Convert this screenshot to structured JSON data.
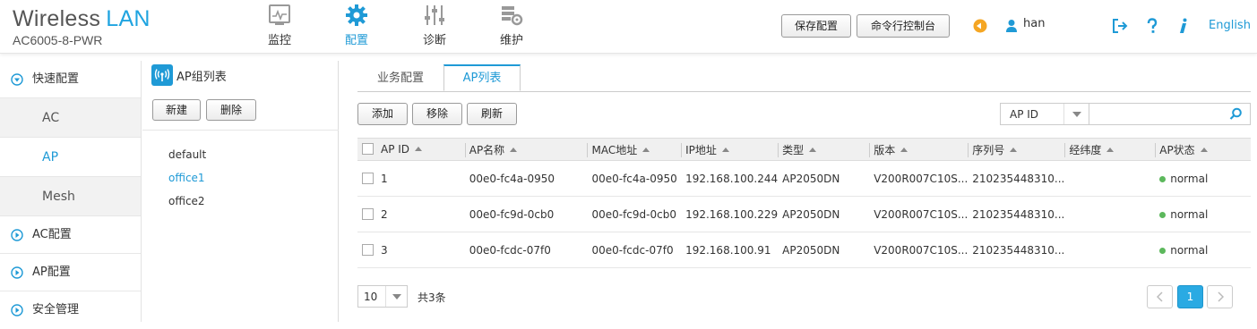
{
  "brand": {
    "title": "Wireless",
    "title_accent": "LAN",
    "model": "AC6005-8-PWR"
  },
  "nav": [
    {
      "label": "监控",
      "icon": "monitor-icon"
    },
    {
      "label": "配置",
      "icon": "gear-icon",
      "active": true
    },
    {
      "label": "诊断",
      "icon": "sliders-icon"
    },
    {
      "label": "维护",
      "icon": "maintenance-icon"
    }
  ],
  "header": {
    "save_label": "保存配置",
    "cli_label": "命令行控制台",
    "user": "han",
    "language": "English"
  },
  "sidebar": {
    "quick": "快速配置",
    "sub": [
      "AC",
      "AP",
      "Mesh"
    ],
    "ac_config": "AC配置",
    "ap_config": "AP配置",
    "security": "安全管理"
  },
  "group_panel": {
    "title": "AP组列表",
    "new_label": "新建",
    "delete_label": "删除",
    "groups": [
      "default",
      "office1",
      "office2"
    ],
    "selected": "office1"
  },
  "tabs": [
    "业务配置",
    "AP列表"
  ],
  "toolbar": {
    "add": "添加",
    "remove": "移除",
    "refresh": "刷新"
  },
  "search": {
    "field": "AP ID",
    "placeholder": ""
  },
  "table": {
    "columns": [
      "AP ID",
      "AP名称",
      "MAC地址",
      "IP地址",
      "类型",
      "版本",
      "序列号",
      "经纬度",
      "AP状态"
    ],
    "rows": [
      {
        "id": "1",
        "name": "00e0-fc4a-0950",
        "mac": "00e0-fc4a-0950",
        "ip": "192.168.100.244",
        "type": "AP2050DN",
        "version": "V200R007C10S...",
        "serial": "210235448310...",
        "geo": "",
        "status": "normal"
      },
      {
        "id": "2",
        "name": "00e0-fc9d-0cb0",
        "mac": "00e0-fc9d-0cb0",
        "ip": "192.168.100.229",
        "type": "AP2050DN",
        "version": "V200R007C10S...",
        "serial": "210235448310...",
        "geo": "",
        "status": "normal"
      },
      {
        "id": "3",
        "name": "00e0-fcdc-07f0",
        "mac": "00e0-fcdc-07f0",
        "ip": "192.168.100.91",
        "type": "AP2050DN",
        "version": "V200R007C10S...",
        "serial": "210235448310...",
        "geo": "",
        "status": "normal"
      }
    ]
  },
  "pager": {
    "page_size": "10",
    "total": "共3条",
    "current_page": "1"
  },
  "colors": {
    "accent": "#1f9ad6",
    "status_normal": "#5cb85c",
    "user_orange": "#f5a623"
  }
}
